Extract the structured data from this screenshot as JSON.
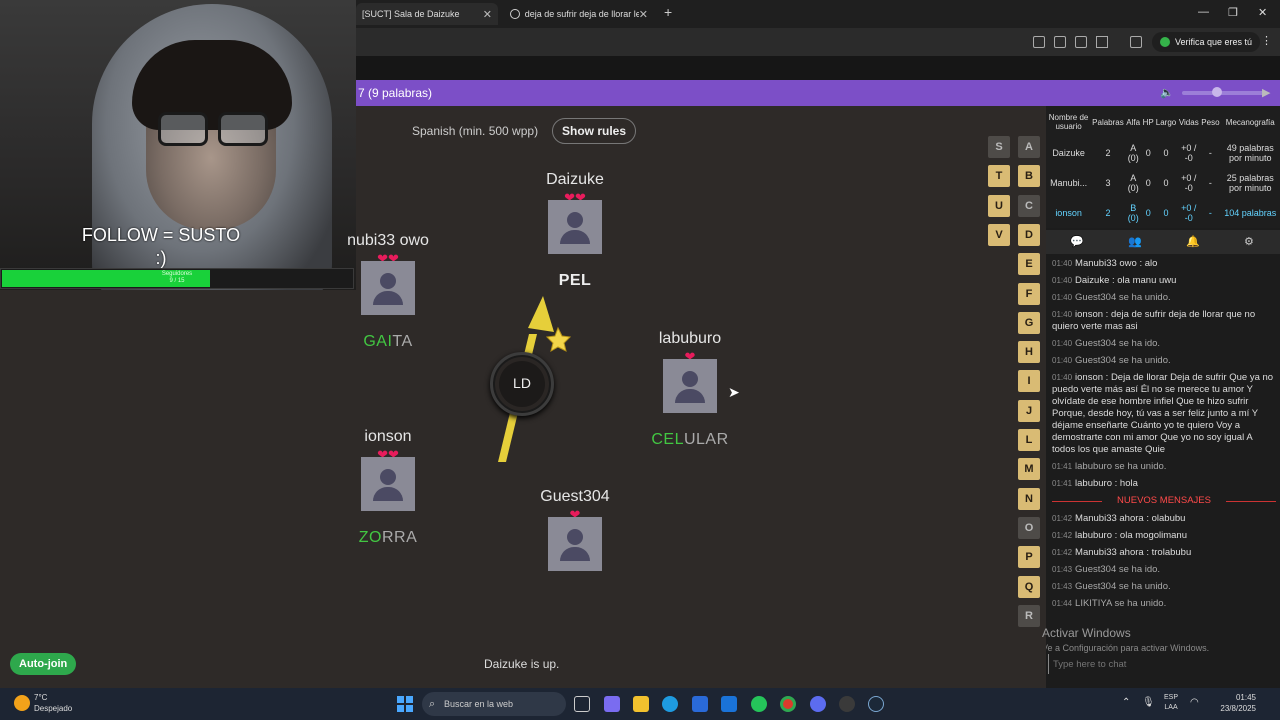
{
  "browser": {
    "tabs": [
      {
        "label": "[SUCT] Sala de Daizuke",
        "close": "✕"
      },
      {
        "label": "deja de sufrir deja de llorar letr",
        "close": "✕"
      }
    ],
    "new_tab": "+",
    "window_controls": [
      "—",
      "❐",
      "✕"
    ],
    "verify_label": "Verifica que eres tú"
  },
  "webcam": {
    "overlay_text": "FOLLOW = SUSTO\n:)",
    "follow_bar_label": "Seguidores\n9 / 15",
    "follow_progress": 0.59
  },
  "room": {
    "title": "7 (9 palabras)",
    "volume_icon": "🔈",
    "play_icon": "▶"
  },
  "game": {
    "language_info": "Spanish (min. 500 wpp)",
    "show_rules_label": "Show rules",
    "bomb_syllable": "LD",
    "players": [
      {
        "name": "Daizuke",
        "hearts": "❤❤",
        "word_typed": "",
        "word_rest": "",
        "current": "PEL"
      },
      {
        "name": "nubi33 owo",
        "hearts": "❤❤",
        "word_typed": "GAI",
        "word_rest": "TA",
        "current": ""
      },
      {
        "name": "labuburo",
        "hearts": "❤",
        "word_typed": "CEL",
        "word_rest": "ULAR",
        "current": ""
      },
      {
        "name": "ionson",
        "hearts": "❤❤",
        "word_typed": "ZO",
        "word_rest": "RRA",
        "current": ""
      },
      {
        "name": "Guest304",
        "hearts": "❤",
        "word_typed": "",
        "word_rest": "",
        "current": ""
      }
    ],
    "letters_col1": [
      {
        "letter": "S",
        "used": true
      },
      {
        "letter": "T",
        "used": false
      },
      {
        "letter": "U",
        "used": false
      },
      {
        "letter": "V",
        "used": false
      }
    ],
    "letters_col2": [
      {
        "letter": "A",
        "used": true
      },
      {
        "letter": "B",
        "used": false
      },
      {
        "letter": "C",
        "used": true
      },
      {
        "letter": "D",
        "used": false
      },
      {
        "letter": "E",
        "used": false
      },
      {
        "letter": "F",
        "used": false
      },
      {
        "letter": "G",
        "used": false
      },
      {
        "letter": "H",
        "used": false
      },
      {
        "letter": "I",
        "used": false
      },
      {
        "letter": "J",
        "used": false
      },
      {
        "letter": "L",
        "used": false
      },
      {
        "letter": "M",
        "used": false
      },
      {
        "letter": "N",
        "used": false
      },
      {
        "letter": "O",
        "used": true
      },
      {
        "letter": "P",
        "used": false
      },
      {
        "letter": "Q",
        "used": false
      },
      {
        "letter": "R",
        "used": true
      }
    ],
    "auto_join_label": "Auto-join",
    "status_text": "Daizuke is up."
  },
  "scoreboard": {
    "headers": [
      "Nombre de usuario",
      "Palabras",
      "Alfa",
      "HP",
      "Largo",
      "Vidas",
      "Peso",
      "Mecanografía"
    ],
    "rows": [
      [
        "Daizuke",
        "2",
        "A (0)",
        "0",
        "0",
        "+0 / -0",
        "-",
        "49 palabras por minuto"
      ],
      [
        "Manubi...",
        "3",
        "A (0)",
        "0",
        "0",
        "+0 / -0",
        "-",
        "25 palabras por minuto"
      ],
      [
        "ionson",
        "2",
        "B (0)",
        "0",
        "0",
        "+0 / -0",
        "-",
        "104 palabras"
      ]
    ]
  },
  "chat": {
    "tabs": [
      "💬",
      "👥",
      "🔔",
      "⚙"
    ],
    "messages": [
      {
        "time": "01:40",
        "author": "Manubi33 owo",
        "text": " : alo",
        "system": false
      },
      {
        "time": "01:40",
        "author": "Daizuke",
        "text": " : ola manu uwu",
        "system": false
      },
      {
        "time": "01:40",
        "author": "",
        "text": "Guest304 se ha unido.",
        "system": true
      },
      {
        "time": "01:40",
        "author": "ionson",
        "text": " : deja de sufrir deja de llorar que no quiero verte mas asi",
        "system": false
      },
      {
        "time": "01:40",
        "author": "",
        "text": "Guest304 se ha ido.",
        "system": true
      },
      {
        "time": "01:40",
        "author": "",
        "text": "Guest304 se ha unido.",
        "system": true
      },
      {
        "time": "01:40",
        "author": "ionson",
        "text": " : Deja de llorar Deja de sufrir Que ya no puedo verte más así Él no se merece tu amor Y olvídate de ese hombre infiel Que te hizo sufrir Porque, desde hoy, tú vas a ser feliz junto a mí Y déjame enseñarte Cuánto yo te quiero Voy a demostrarte con mi amor Que yo no soy igual A todos los que amaste Quie",
        "system": false
      },
      {
        "time": "01:41",
        "author": "",
        "text": "labuburo se ha unido.",
        "system": true
      },
      {
        "time": "01:41",
        "author": "labuburo",
        "text": " : hola",
        "system": false
      }
    ],
    "new_messages_label": "NUEVOS MENSAJES",
    "messages_new": [
      {
        "time": "01:42",
        "author": "Manubi33 ahora",
        "text": " : olabubu",
        "system": false
      },
      {
        "time": "01:42",
        "author": "labuburo",
        "text": " : ola mogolimanu",
        "system": false
      },
      {
        "time": "01:42",
        "author": "Manubi33 ahora",
        "text": " : trolabubu",
        "system": false
      },
      {
        "time": "01:43",
        "author": "",
        "text": "Guest304 se ha ido.",
        "system": true
      },
      {
        "time": "01:43",
        "author": "",
        "text": "Guest304 se ha unido.",
        "system": true
      },
      {
        "time": "01:44",
        "author": "",
        "text": "LIKITIYA se ha unido.",
        "system": true
      }
    ],
    "input_placeholder": "Type here to chat"
  },
  "windows": {
    "activate_title": "Activar Windows",
    "activate_sub": "Ve a Configuración para activar Windows.",
    "weather_temp": "7°C",
    "weather_desc": "Despejado",
    "search_placeholder": "Buscar en la web",
    "lang_line1": "ESP",
    "lang_line2": "LAA",
    "time": "01:45",
    "date": "23/8/2025"
  }
}
